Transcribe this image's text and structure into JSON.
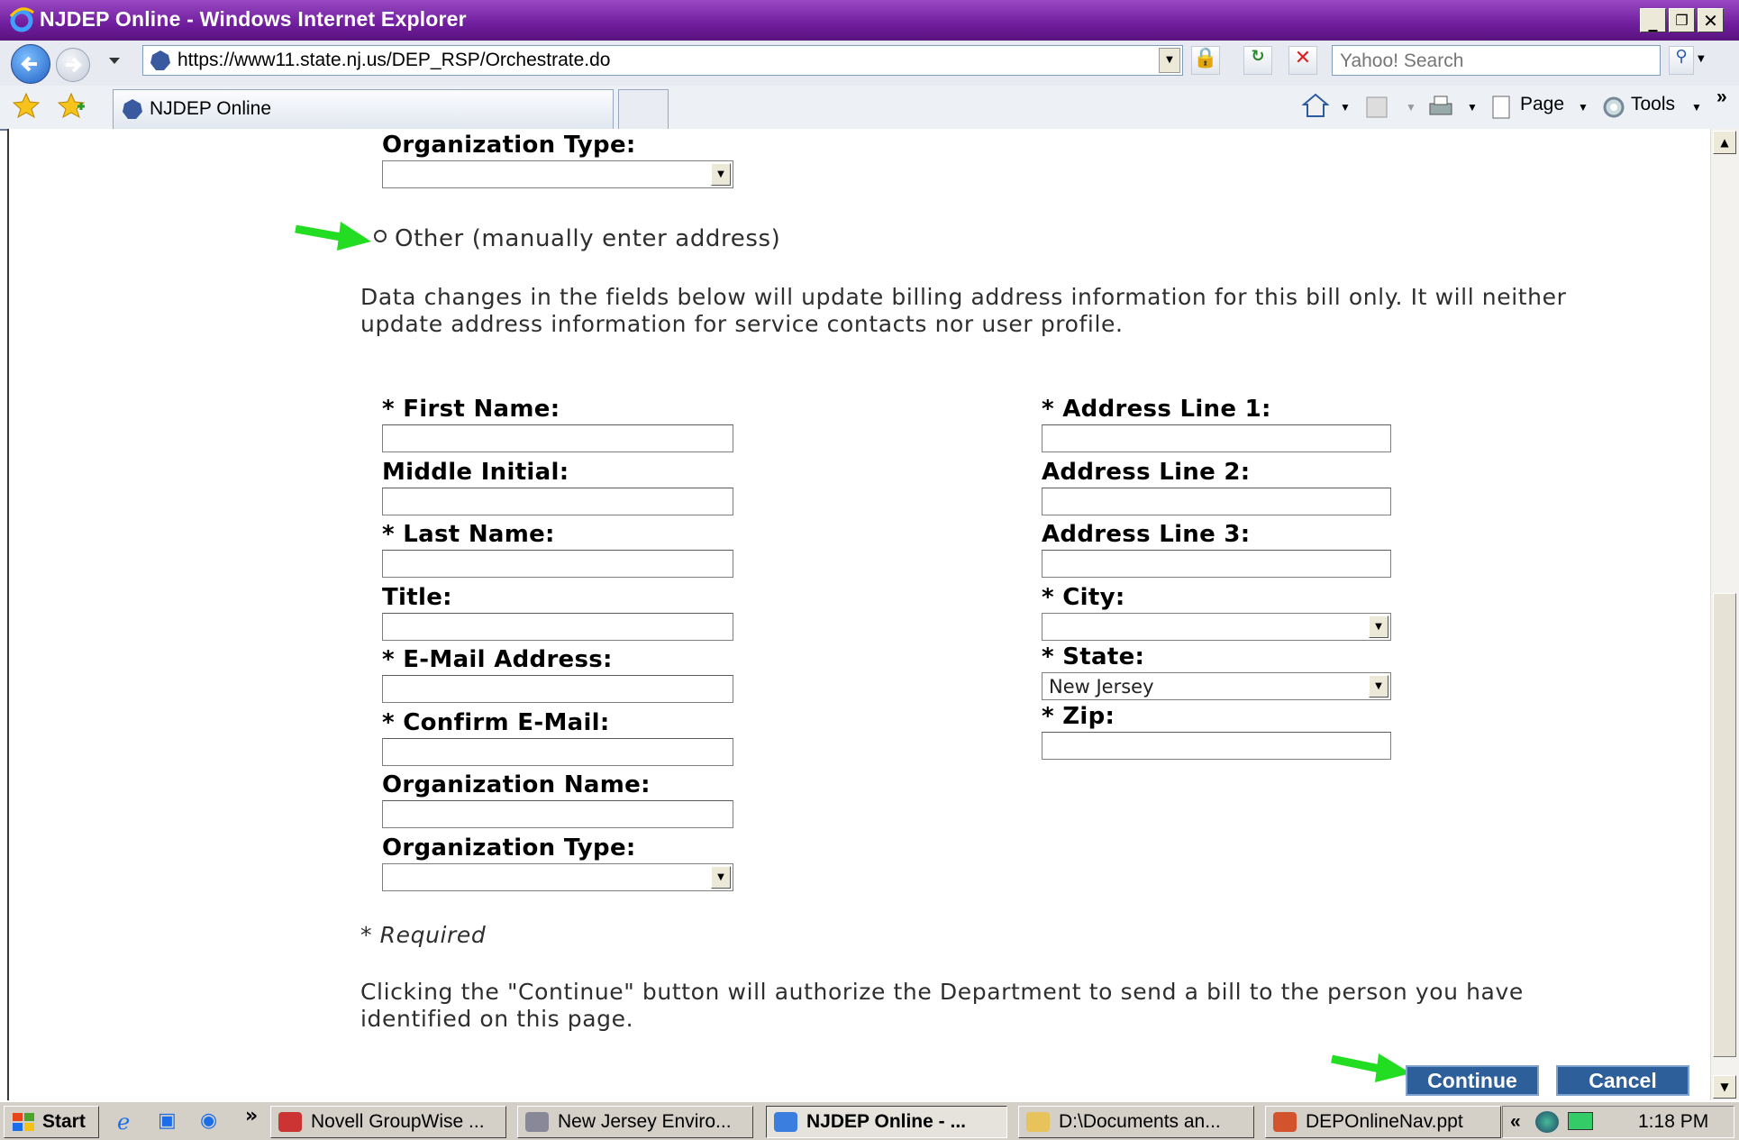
{
  "window": {
    "title": "NJDEP Online - Windows Internet Explorer"
  },
  "browser": {
    "url": "https://www11.state.nj.us/DEP_RSP/Orchestrate.do",
    "search_placeholder": "Yahoo! Search",
    "tab_title": "NJDEP Online",
    "commands": {
      "page": "Page",
      "tools": "Tools"
    }
  },
  "form": {
    "top_org_type_label": "Organization Type:",
    "other_option_label": "Other (manually enter address)",
    "info_text_line1": "Data changes in the fields below will update billing address information for this bill only. It will neither",
    "info_text_line2": "update address information for service contacts nor user profile.",
    "left_fields": {
      "first_name": "* First Name:",
      "middle_initial": "Middle Initial:",
      "last_name": "* Last Name:",
      "title": "Title:",
      "email": "* E-Mail Address:",
      "confirm_email": "* Confirm E-Mail:",
      "org_name": "Organization Name:",
      "org_type": "Organization Type:"
    },
    "right_fields": {
      "address1": "* Address Line 1:",
      "address2": "Address Line 2:",
      "address3": "Address Line 3:",
      "city": "* City:",
      "state": "* State:",
      "state_value": "New Jersey",
      "zip": "* Zip:"
    },
    "required_note": "* Required",
    "continue_note_line1": "Clicking the \"Continue\" button will authorize the Department to send a bill to the person you have",
    "continue_note_line2": "identified on this page.",
    "continue_button": "Continue",
    "cancel_button": "Cancel"
  },
  "taskbar": {
    "start": "Start",
    "items": [
      "Novell GroupWise ...",
      "New Jersey Enviro...",
      "NJDEP Online - ...",
      "D:\\Documents an...",
      "DEPOnlineNav.ppt"
    ],
    "clock": "1:18 PM"
  },
  "colors": {
    "titlebar": "#6f1d9c",
    "button_bg": "#2d5f9b",
    "highlight_arrow": "#22dd22"
  }
}
